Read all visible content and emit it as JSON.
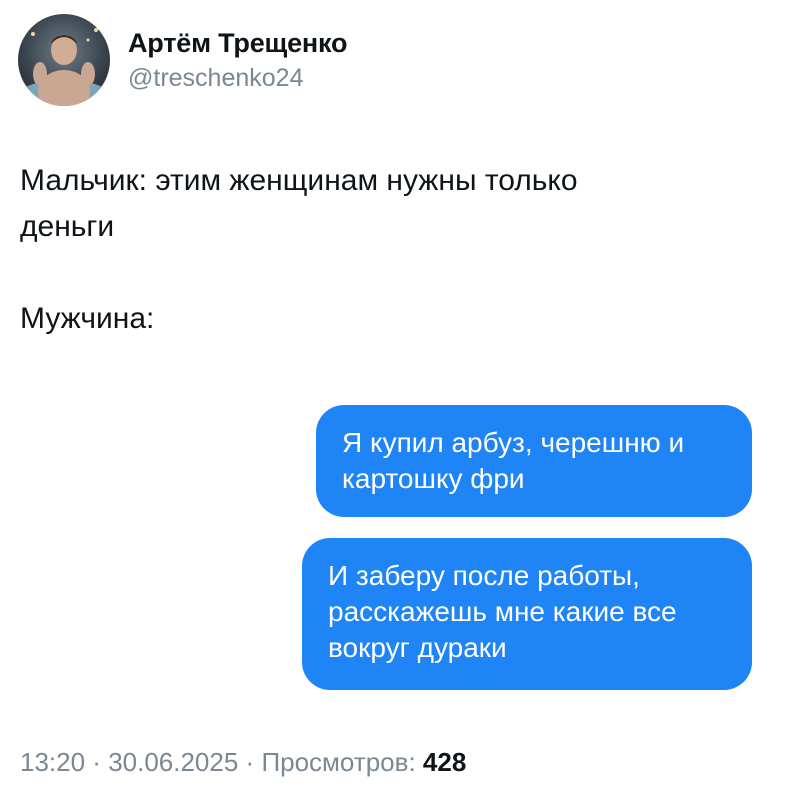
{
  "author": {
    "display_name": "Артём Трещенко",
    "handle": "@treschenko24"
  },
  "tweet": {
    "line1": "Мальчик: этим женщинам нужны только",
    "line2": "деньги",
    "line3": "Мужчина:"
  },
  "messages": [
    {
      "line1": "Я купил арбуз, черешню и",
      "line2": "картошку фри"
    },
    {
      "line1": "И заберу после работы,",
      "line2": "расскажешь мне какие все",
      "line3": "вокруг дураки"
    }
  ],
  "footer": {
    "time": "13:20",
    "separator": " · ",
    "date": "30.06.2025",
    "views_label": "Просмотров: ",
    "views_count": "428"
  },
  "colors": {
    "bubble": "#1f84f5",
    "secondary_text": "#7b8792",
    "primary_text": "#0f1419"
  }
}
